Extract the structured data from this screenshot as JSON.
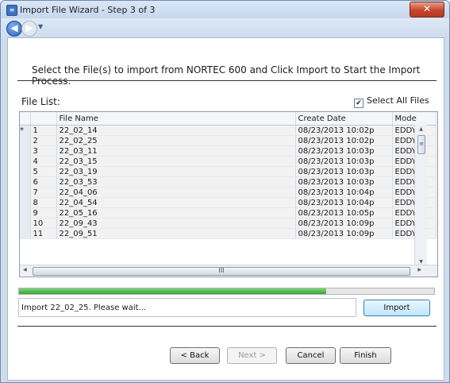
{
  "window": {
    "title": "Import File Wizard - Step 3 of 3",
    "close_label": "✕"
  },
  "nav": {
    "back_glyph": "◀",
    "forward_glyph": "▶",
    "dropdown_glyph": "▼"
  },
  "instructions": "Select the File(s) to import from NORTEC 600 and Click Import to Start the Import Process.",
  "file_list": {
    "label": "File List:",
    "select_all_label": "Select All Files",
    "select_all_checked": true,
    "columns": [
      "File Name",
      "Create Date",
      "Mode"
    ],
    "current_row_marker": "*",
    "rows": [
      {
        "num": "1",
        "name": "22_02_14",
        "date": "08/23/2013 10:02p",
        "mode": "EDDY"
      },
      {
        "num": "2",
        "name": "22_02_25",
        "date": "08/23/2013 10:02p",
        "mode": "EDDY"
      },
      {
        "num": "3",
        "name": "22_03_11",
        "date": "08/23/2013 10:03p",
        "mode": "EDDY"
      },
      {
        "num": "4",
        "name": "22_03_15",
        "date": "08/23/2013 10:03p",
        "mode": "EDDY"
      },
      {
        "num": "5",
        "name": "22_03_19",
        "date": "08/23/2013 10:03p",
        "mode": "EDDY"
      },
      {
        "num": "6",
        "name": "22_03_53",
        "date": "08/23/2013 10:03p",
        "mode": "EDDY"
      },
      {
        "num": "7",
        "name": "22_04_06",
        "date": "08/23/2013 10:04p",
        "mode": "EDDY"
      },
      {
        "num": "8",
        "name": "22_04_54",
        "date": "08/23/2013 10:04p",
        "mode": "EDDY"
      },
      {
        "num": "9",
        "name": "22_05_16",
        "date": "08/23/2013 10:05p",
        "mode": "EDDY"
      },
      {
        "num": "10",
        "name": "22_09_43",
        "date": "08/23/2013 10:09p",
        "mode": "EDDY"
      },
      {
        "num": "11",
        "name": "22_09_51",
        "date": "08/23/2013 10:09p",
        "mode": "EDDY"
      }
    ],
    "scrollbar": {
      "thumb_grip": "≡",
      "hthumb_grip": "III"
    }
  },
  "progress": {
    "fraction": 0.74,
    "color": "#37a534"
  },
  "status_text": "Import 22_02_25.  Please wait...",
  "buttons": {
    "import": "Import",
    "back": "< Back",
    "next": "Next >",
    "cancel": "Cancel",
    "finish": "Finish"
  }
}
